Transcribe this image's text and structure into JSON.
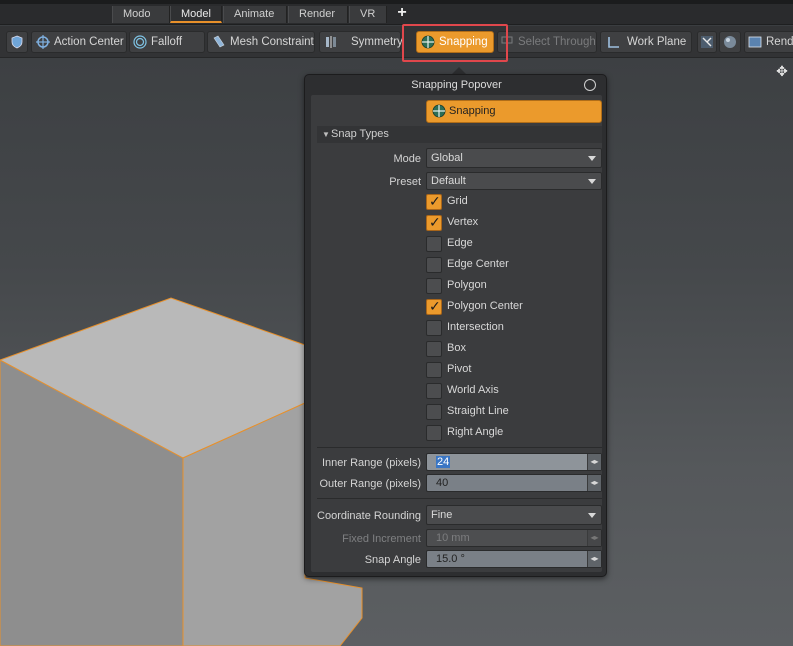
{
  "tabs": [
    {
      "label": "Modo"
    },
    {
      "label": "Model",
      "active": true
    },
    {
      "label": "Animate"
    },
    {
      "label": "Render"
    },
    {
      "label": "VR"
    }
  ],
  "tab_add": "+",
  "toolbar": {
    "action_center": "Action Center",
    "falloff": "Falloff",
    "mesh_constraint": "Mesh Constraint",
    "symmetry": "Symmetry",
    "snapping": "Snapping",
    "select_through": "Select Through",
    "work_plane": "Work Plane",
    "render": "Rend"
  },
  "popover": {
    "title": "Snapping Popover",
    "snapping_button": "Snapping",
    "section": "Snap Types",
    "mode_label": "Mode",
    "mode_value": "Global",
    "preset_label": "Preset",
    "preset_value": "Default",
    "snap_types": [
      {
        "label": "Grid",
        "checked": true
      },
      {
        "label": "Vertex",
        "checked": true
      },
      {
        "label": "Edge",
        "checked": false
      },
      {
        "label": "Edge Center",
        "checked": false
      },
      {
        "label": "Polygon",
        "checked": false
      },
      {
        "label": "Polygon Center",
        "checked": true
      },
      {
        "label": "Intersection",
        "checked": false
      },
      {
        "label": "Box",
        "checked": false
      },
      {
        "label": "Pivot",
        "checked": false
      },
      {
        "label": "World Axis",
        "checked": false
      },
      {
        "label": "Straight Line",
        "checked": false
      },
      {
        "label": "Right Angle",
        "checked": false
      }
    ],
    "inner_range_label": "Inner Range (pixels)",
    "inner_range_value": "24",
    "outer_range_label": "Outer Range (pixels)",
    "outer_range_value": "40",
    "coord_rounding_label": "Coordinate Rounding",
    "coord_rounding_value": "Fine",
    "fixed_increment_label": "Fixed Increment",
    "fixed_increment_value": "10 mm",
    "snap_angle_label": "Snap Angle",
    "snap_angle_value": "15.0 °"
  },
  "colors": {
    "accent": "#eb9a2c",
    "highlight_box": "#e0474c",
    "cube_edge": "#e8902a"
  }
}
